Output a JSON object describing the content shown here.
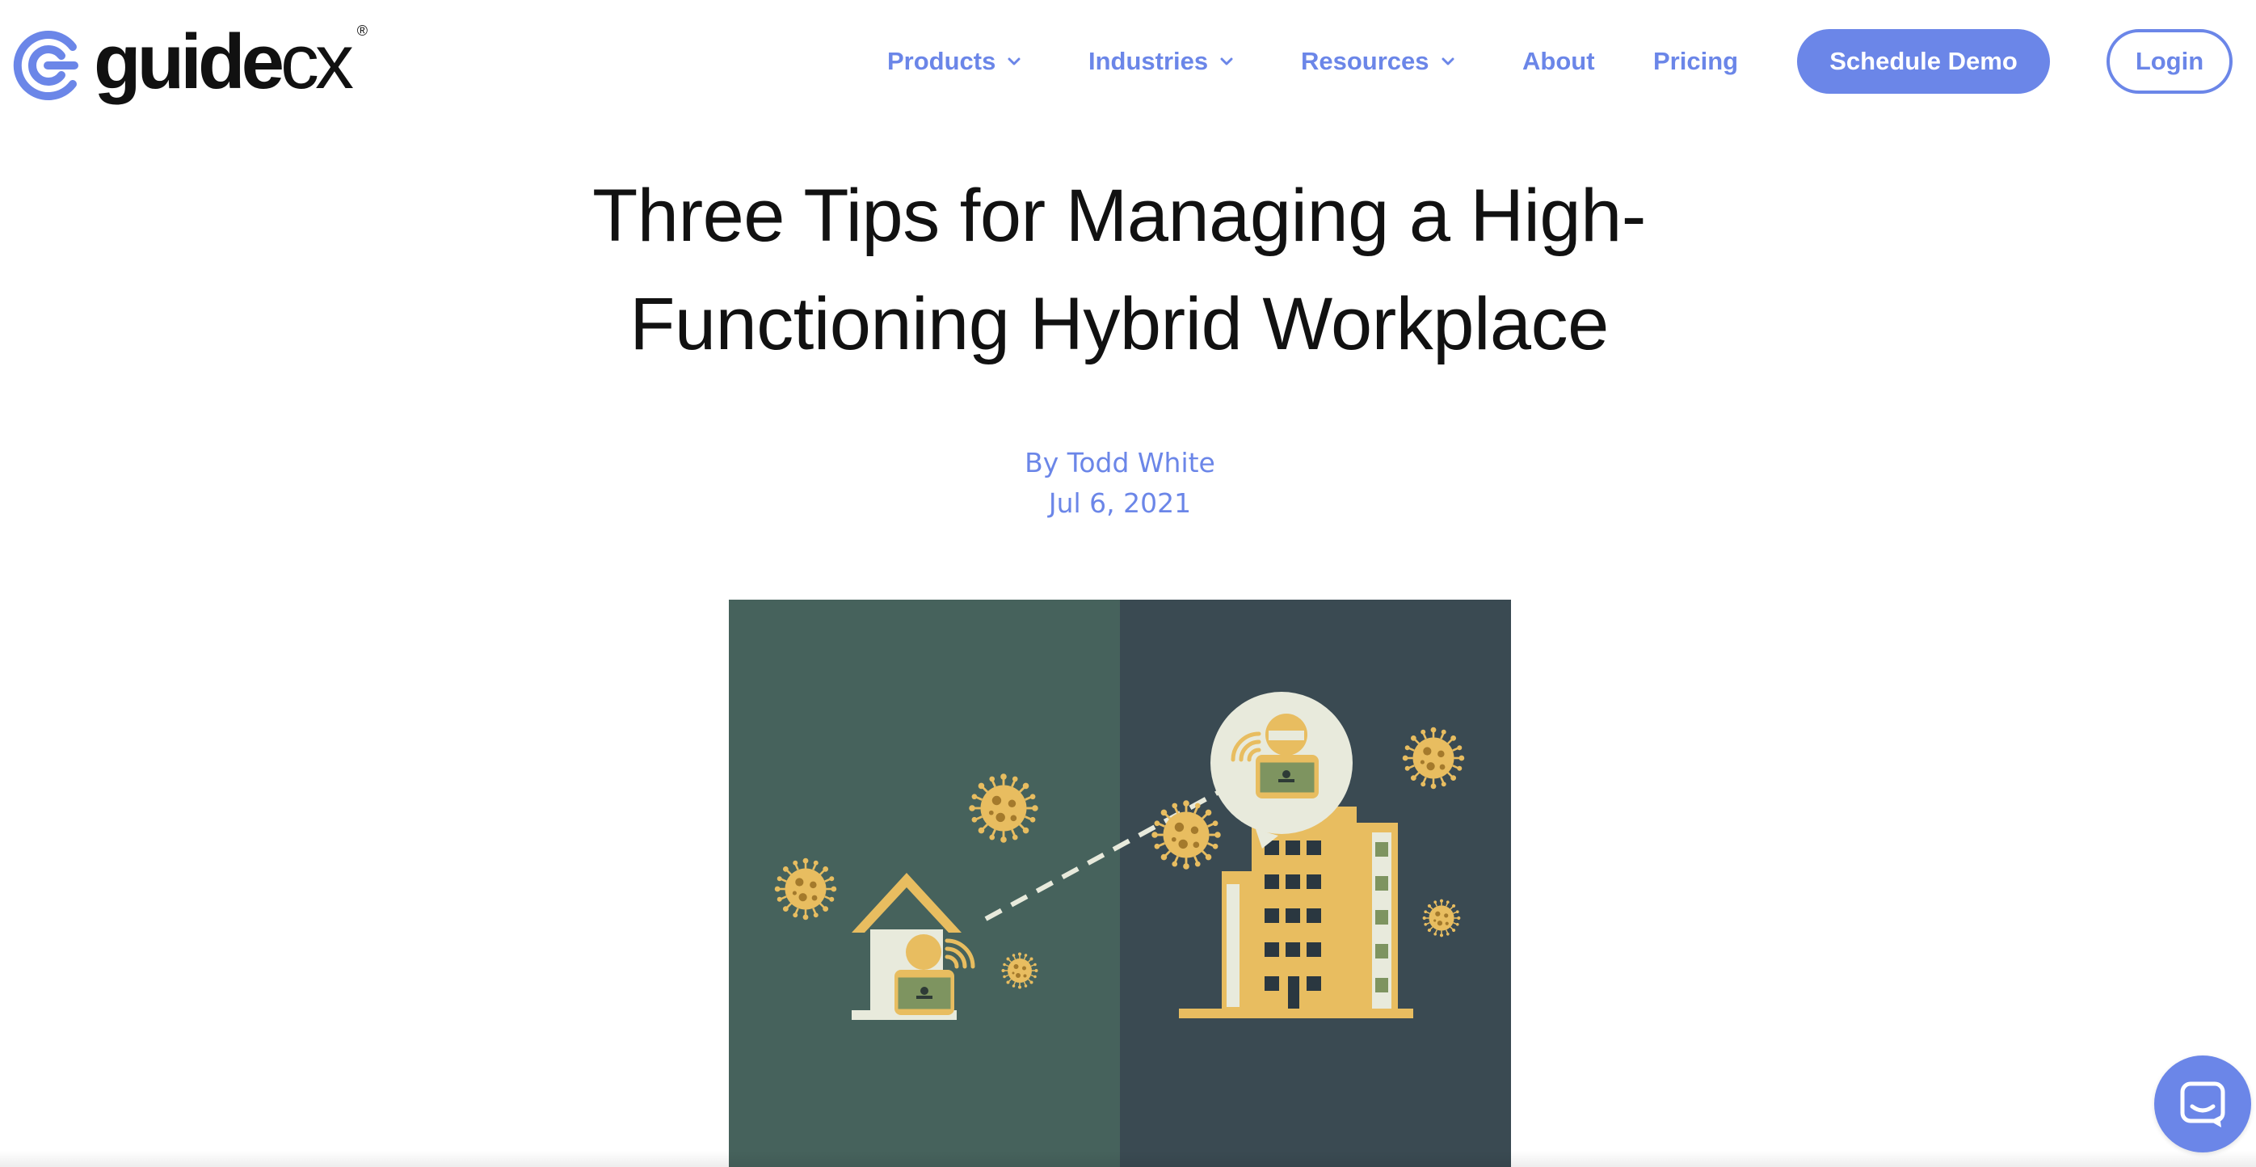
{
  "header": {
    "logo": {
      "name": "guidecx",
      "reg_mark": "®"
    },
    "nav": [
      {
        "label": "Products",
        "has_dropdown": true
      },
      {
        "label": "Industries",
        "has_dropdown": true
      },
      {
        "label": "Resources",
        "has_dropdown": true
      },
      {
        "label": "About",
        "has_dropdown": false
      },
      {
        "label": "Pricing",
        "has_dropdown": false
      }
    ],
    "schedule_demo_label": "Schedule Demo",
    "login_label": "Login"
  },
  "article": {
    "title": "Three Tips for Managing a High-Functioning Hybrid Workplace",
    "byline": "By Todd White",
    "date": "Jul 6, 2021"
  },
  "colors": {
    "accent": "#6b86e8",
    "title_text": "#111111",
    "hero_left_bg": "#46625c",
    "hero_right_bg": "#3a4a52",
    "hero_yellow": "#e8bd60",
    "hero_cream": "#e8eadc",
    "hero_green": "#7e9460"
  },
  "icons": {
    "logo_mark": "guidecx-g-logo-icon",
    "dropdown": "chevron-down-icon",
    "chat": "chat-bubble-icon",
    "virus": "virus-icon",
    "house": "house-icon",
    "office_building": "office-building-icon",
    "person_laptop": "person-laptop-icon",
    "wifi": "wifi-signal-icon"
  }
}
